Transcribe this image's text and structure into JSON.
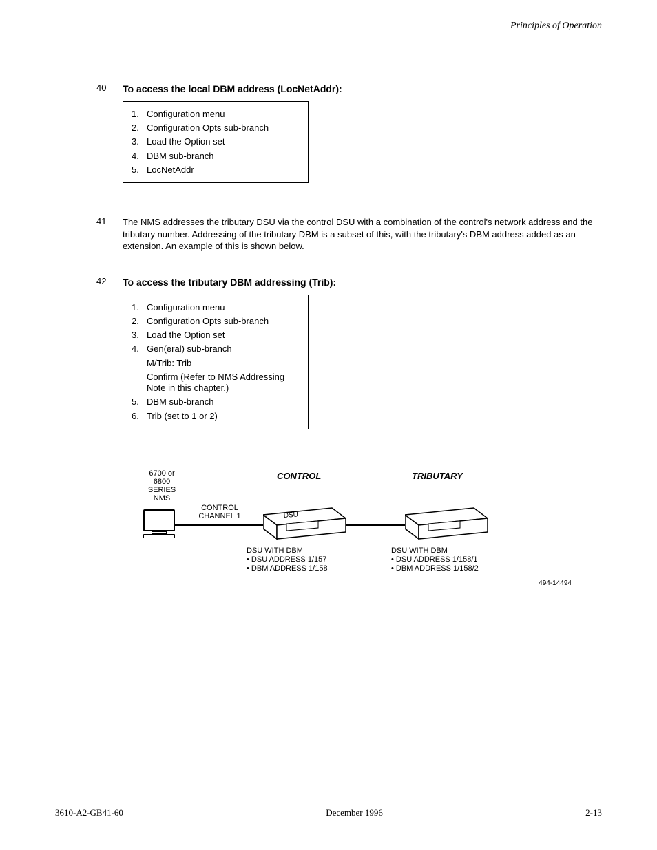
{
  "header": {
    "chapter": "Principles of Operation"
  },
  "footer": {
    "docnum": "3610-A2-GB41-60",
    "date": "December 1996",
    "page": "2-13"
  },
  "sect_40n": {
    "title": "To access the local DBM address (LocNetAddr):",
    "num": "40",
    "box": {
      "l1n": "1.",
      "l1": "Configuration menu",
      "l2n": "2.",
      "l2": "Configuration Opts sub-branch",
      "l3n": "3.",
      "l3": "Load the Option set",
      "l4n": "4.",
      "l4": "DBM sub-branch",
      "l5n": "5.",
      "l5": "LocNetAddr"
    }
  },
  "sect_41n": {
    "num": "41",
    "text": "The NMS addresses the tributary DSU via the control DSU with a combination of the control's network address and the tributary number. Addressing of the tributary DBM is a subset of this, with the tributary's DBM address added as an extension. An example of this is shown below."
  },
  "sect_42n": {
    "title": "To access the tributary DBM addressing (Trib):",
    "num": "42",
    "box": {
      "l1n": "1.",
      "l1": "Configuration menu",
      "l2n": "2.",
      "l2": "Configuration Opts sub-branch",
      "l3n": "3.",
      "l3": "Load the Option set",
      "l4n": "4.",
      "l4": "Gen(eral) sub-branch",
      "nt1": "M/Trib: Trib",
      "nt2": "Confirm (Refer to NMS Addressing",
      "nt3": "Note in this chapter.)",
      "l5n": "5.",
      "l5": "DBM sub-branch",
      "l6n": "6.",
      "l6": "Trib (set to 1 or 2)"
    }
  },
  "diagram": {
    "nms": "6700 or\n6800\nSERIES\nNMS",
    "cc": "CONTROL\nCHANNEL 1",
    "role1": "CONTROL",
    "role2": "TRIBUTARY",
    "dsu_tag": "DSU",
    "cap1_t": "DSU WITH DBM",
    "cap1_a": "• DSU ADDRESS 1/157",
    "cap1_b": "• DBM ADDRESS 1/158",
    "cap2_t": "DSU WITH DBM",
    "cap2_a": "• DSU ADDRESS 1/158/1",
    "cap2_b": "• DBM ADDRESS 1/158/2",
    "fig": "494-14494"
  }
}
